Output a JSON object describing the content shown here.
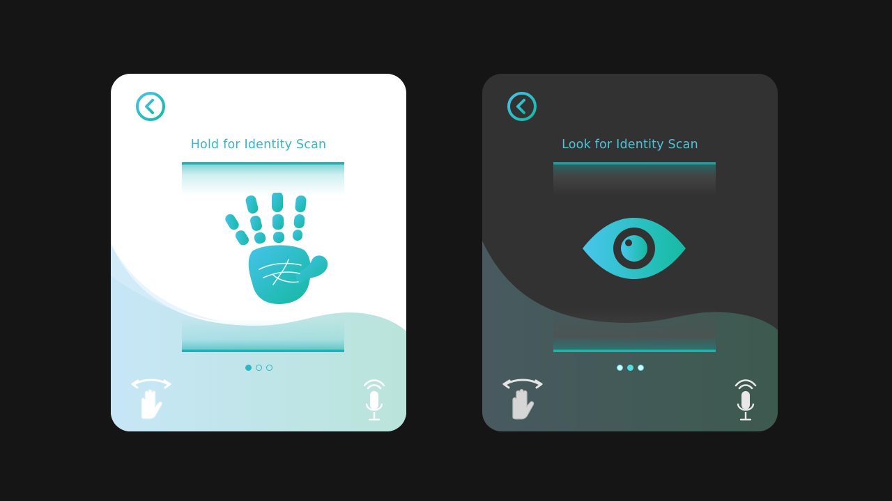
{
  "cards": [
    {
      "theme": "light",
      "title": "Hold for Identity Scan",
      "scan_type": "palm",
      "icons": {
        "back": "back-arrow-icon",
        "scan": "hand-print-icon",
        "gesture": "swipe-hand-icon",
        "voice": "microphone-icon"
      },
      "pagination": {
        "total": 3,
        "active": 1
      }
    },
    {
      "theme": "dark",
      "title": "Look for Identity Scan",
      "scan_type": "iris",
      "icons": {
        "back": "back-arrow-icon",
        "scan": "eye-icon",
        "gesture": "swipe-hand-icon",
        "voice": "microphone-icon"
      },
      "pagination": {
        "total": 3,
        "active": 2
      }
    }
  ],
  "colors": {
    "page_background": "#161516",
    "accent_teal": "#20b2b6",
    "accent_cyan": "#45c2e8",
    "light_card": "#ffffff",
    "dark_card": "#323232"
  }
}
